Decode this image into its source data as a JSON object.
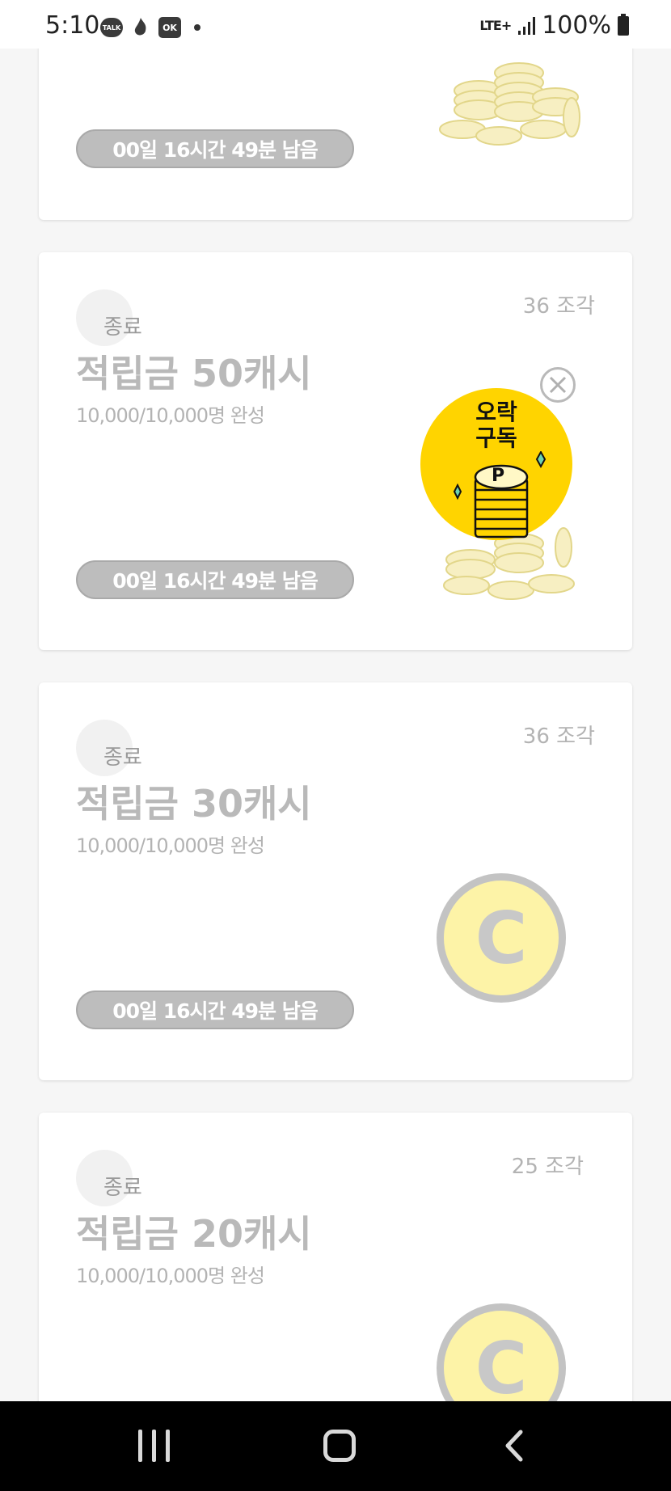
{
  "status_bar": {
    "time": "5:10",
    "talk_label": "TALK",
    "ok_label": "OK",
    "network": "LTE+",
    "battery": "100%"
  },
  "cards": [
    {
      "timer": "00일 16시간 49분 남음"
    },
    {
      "status": "종료",
      "title": "적립금 50캐시",
      "progress": "10,000/10,000명 완성",
      "pieces": "36 조각",
      "timer": "00일 16시간 49분 남음",
      "popup_text_line1": "오락",
      "popup_text_line2": "구독",
      "popup_coin_letter": "P"
    },
    {
      "status": "종료",
      "title": "적립금 30캐시",
      "progress": "10,000/10,000명 완성",
      "pieces": "36 조각",
      "timer": "00일 16시간 49분 남음",
      "coin_letter": "C"
    },
    {
      "status": "종료",
      "title": "적립금 20캐시",
      "progress": "10,000/10,000명 완성",
      "pieces": "25 조각",
      "coin_letter": "C"
    }
  ],
  "colors": {
    "popup_yellow": "#ffd400",
    "coin_fill": "#fdf3a7",
    "timer_bg": "#bdbdbd"
  }
}
